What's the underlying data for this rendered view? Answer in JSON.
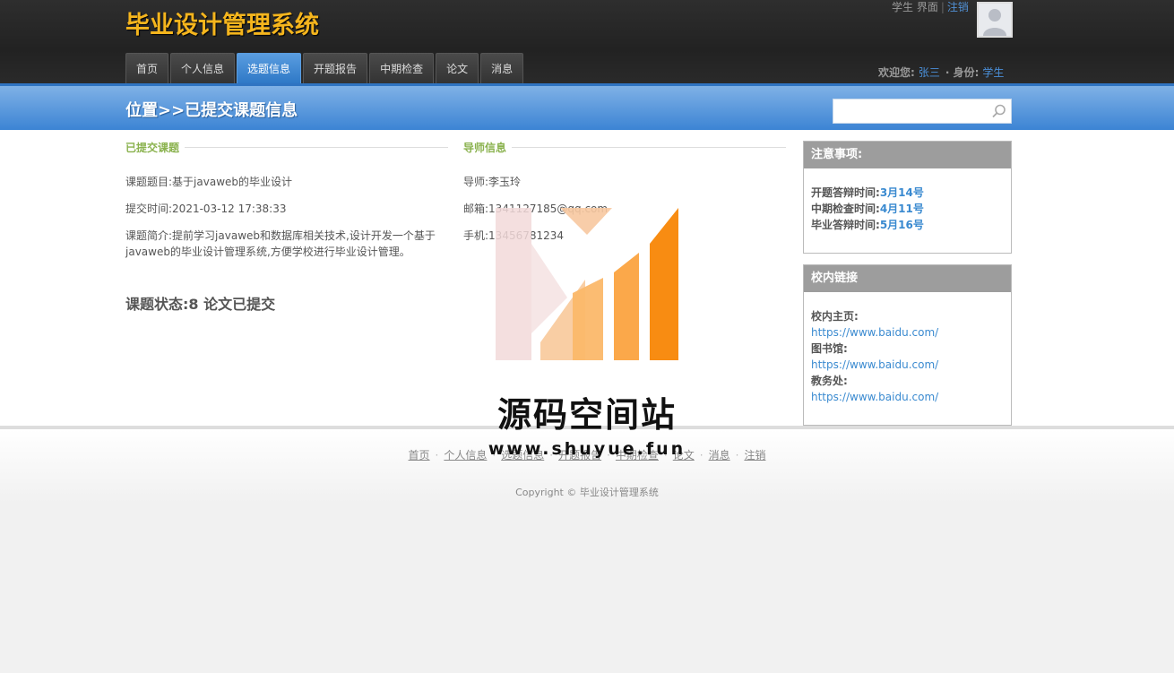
{
  "header": {
    "site_title": "毕业设计管理系统",
    "top_role": "学生",
    "top_interface": "界面",
    "top_logout": "注销",
    "welcome_label": "欢迎您:",
    "user_name": "张三",
    "role_label": "· 身份:",
    "role_value": "学生"
  },
  "nav": {
    "tabs": [
      {
        "label": "首页",
        "active": false
      },
      {
        "label": "个人信息",
        "active": false
      },
      {
        "label": "选题信息",
        "active": true
      },
      {
        "label": "开题报告",
        "active": false
      },
      {
        "label": "中期检查",
        "active": false
      },
      {
        "label": "论文",
        "active": false
      },
      {
        "label": "消息",
        "active": false
      }
    ]
  },
  "location": {
    "title": "位置>>已提交课题信息",
    "search_placeholder": ""
  },
  "topic": {
    "heading": "已提交课题",
    "title_label": "课题题目:",
    "title_value": "基于javaweb的毕业设计",
    "time_label": "提交时间:",
    "time_value": "2021-03-12 17:38:33",
    "intro_label": "课题简介:",
    "intro_value": "提前学习javaweb和数据库相关技术,设计开发一个基于javaweb的毕业设计管理系统,方便学校进行毕业设计管理。",
    "status_label": "课题状态:",
    "status_value": "8 论文已提交"
  },
  "tutor": {
    "heading": "导师信息",
    "name_label": "导师:",
    "name_value": "李玉玲",
    "email_label": "邮箱:",
    "email_value": "1341127185@qq.com",
    "phone_label": "手机:",
    "phone_value": "13456781234"
  },
  "notice": {
    "heading": "注意事项:",
    "items": [
      {
        "label": "开题答辩时间:",
        "date": "3月14号"
      },
      {
        "label": "中期检查时间:",
        "date": "4月11号"
      },
      {
        "label": "毕业答辩时间:",
        "date": "5月16号"
      }
    ]
  },
  "links": {
    "heading": "校内链接",
    "items": [
      {
        "label": "校内主页:",
        "url": "https://www.baidu.com/"
      },
      {
        "label": "图书馆:",
        "url": "https://www.baidu.com/"
      },
      {
        "label": "教务处:",
        "url": "https://www.baidu.com/"
      }
    ]
  },
  "footer": {
    "links": [
      "首页",
      "个人信息",
      "选题信息",
      "开题报告",
      "中期检查",
      "论文",
      "消息",
      "注销"
    ],
    "copyright": "Copyright © 毕业设计管理系统"
  },
  "watermark": {
    "title": "源码空间站",
    "url": "www.shuyue.fun"
  },
  "colors": {
    "brand_title": "#f5b51d",
    "nav_active": "#2e78c6",
    "section_head": "#8ab24e",
    "link": "#3a8ad0"
  }
}
